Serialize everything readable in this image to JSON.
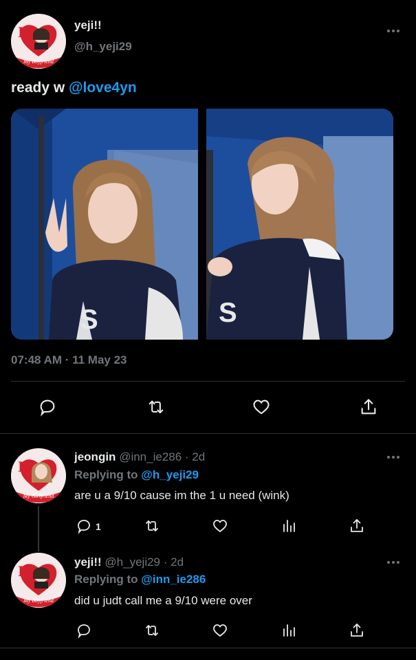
{
  "main_tweet": {
    "name": "yeji!!",
    "handle": "@h_yeji29",
    "avatar_badge": "My Boyfriend",
    "text_prefix": "ready w ",
    "mention": "@love4yn",
    "timestamp": "07:48 AM · 11 May 23",
    "actions": [
      "reply-icon",
      "retweet-icon",
      "like-icon",
      "share-icon"
    ]
  },
  "replies": [
    {
      "name": "jeongin",
      "meta": "@inn_ie286 · 2d",
      "avatar_badge": "My Girlfriend",
      "replying_label": "Replying to ",
      "replying_to": "@h_yeji29",
      "text": "are u a 9/10 cause im the 1 u need (wink)",
      "reply_count": "1"
    },
    {
      "name": "yeji!!",
      "meta": "@h_yeji29 · 2d",
      "avatar_badge": "My Boyfriend",
      "replying_label": "Replying to ",
      "replying_to": "@inn_ie286",
      "text": "did u judt call me a 9/10 were over",
      "reply_count": ""
    }
  ],
  "colors": {
    "background": "#000000",
    "text": "#e7e9ea",
    "muted": "#71767b",
    "accent": "#1d9bf0",
    "divider": "#2f3336",
    "badge_red": "#d4202c"
  }
}
